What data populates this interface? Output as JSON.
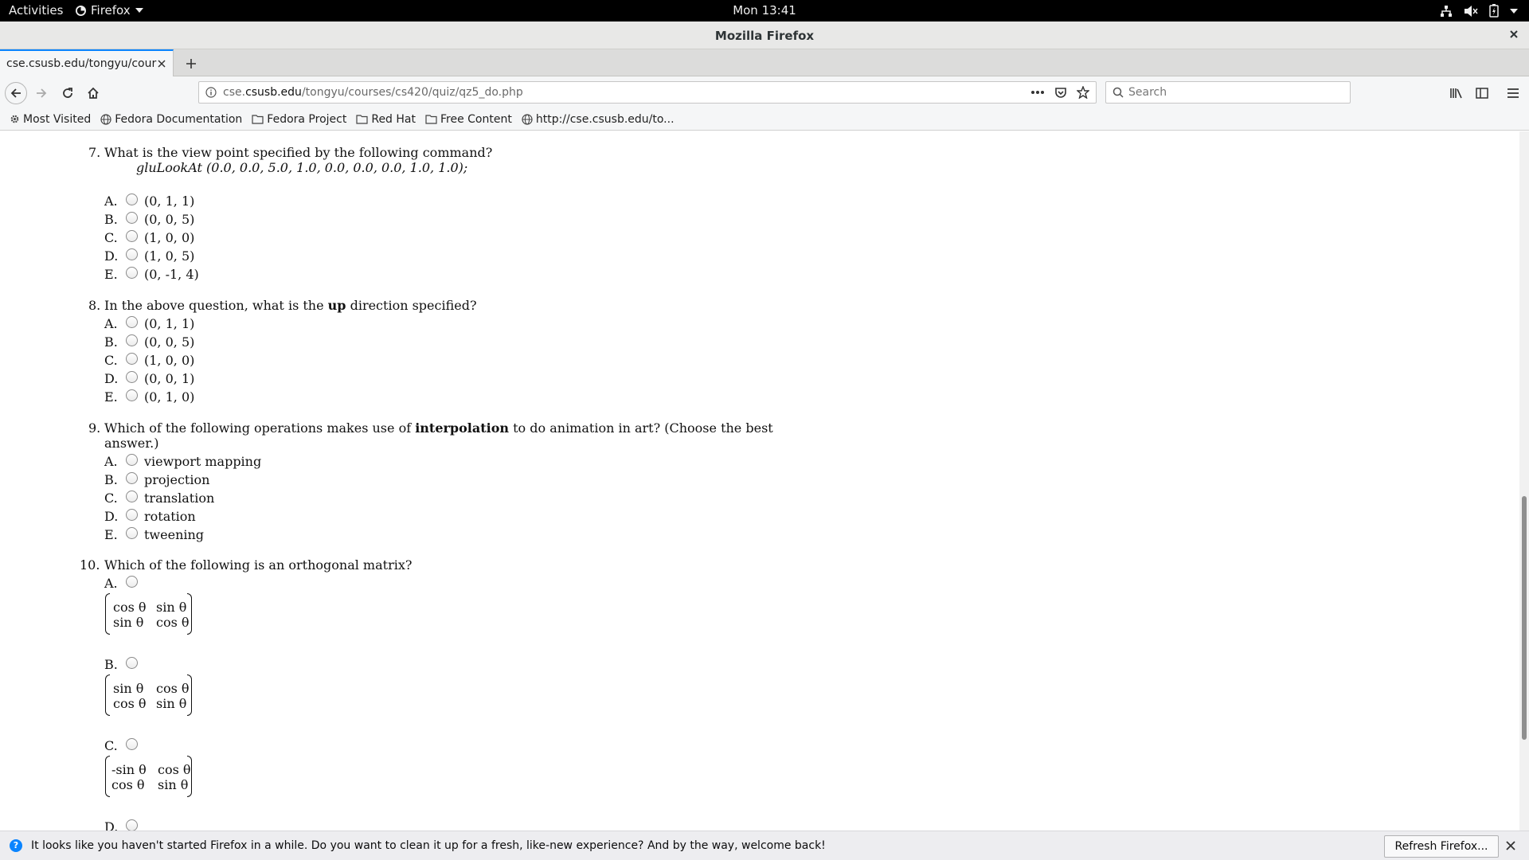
{
  "topbar": {
    "activities": "Activities",
    "app_menu": "Firefox",
    "clock": "Mon 13:41"
  },
  "window": {
    "title": "Mozilla Firefox"
  },
  "tab": {
    "title": "cse.csusb.edu/tongyu/course"
  },
  "urlbar": {
    "url_prefix": "cse.",
    "url_domain": "csusb.edu",
    "url_path": "/tongyu/courses/cs420/quiz/qz5_do.php"
  },
  "searchbar": {
    "placeholder": "Search"
  },
  "bookmarks": [
    {
      "label": "Most Visited",
      "icon": "gear-icon"
    },
    {
      "label": "Fedora Documentation",
      "icon": "globe-icon"
    },
    {
      "label": "Fedora Project",
      "icon": "folder-icon"
    },
    {
      "label": "Red Hat",
      "icon": "folder-icon"
    },
    {
      "label": "Free Content",
      "icon": "folder-icon"
    },
    {
      "label": "http://cse.csusb.edu/to...",
      "icon": "globe-icon"
    }
  ],
  "quiz": {
    "q7": {
      "num": "7.",
      "text": "What is the view point specified by the following command?",
      "code": "gluLookAt (0.0, 0.0, 5.0, 1.0, 0.0, 0.0, 0.0, 1.0, 1.0);",
      "options": [
        {
          "letter": "A.",
          "text": "(0, 1, 1)"
        },
        {
          "letter": "B.",
          "text": "(0, 0, 5)"
        },
        {
          "letter": "C.",
          "text": "(1, 0, 0)"
        },
        {
          "letter": "D.",
          "text": "(1, 0, 5)"
        },
        {
          "letter": "E.",
          "text": "(0, -1, 4)"
        }
      ]
    },
    "q8": {
      "num": "8.",
      "text_before": "In the above question, what is the",
      "text_bold": "up",
      "text_after": "direction specified?",
      "options": [
        {
          "letter": "A.",
          "text": "(0, 1, 1)"
        },
        {
          "letter": "B.",
          "text": "(0, 0, 5)"
        },
        {
          "letter": "C.",
          "text": "(1, 0, 0)"
        },
        {
          "letter": "D.",
          "text": "(0, 0, 1)"
        },
        {
          "letter": "E.",
          "text": "(0, 1, 0)"
        }
      ]
    },
    "q9": {
      "num": "9.",
      "text_before": "Which of the following operations makes use of",
      "text_bold": "interpolation",
      "text_after": "to do animation in art? (Choose the best",
      "text_line2": "answer.)",
      "options": [
        {
          "letter": "A.",
          "text": "viewport mapping"
        },
        {
          "letter": "B.",
          "text": "projection"
        },
        {
          "letter": "C.",
          "text": "translation"
        },
        {
          "letter": "D.",
          "text": "rotation"
        },
        {
          "letter": "E.",
          "text": "tweening"
        }
      ]
    },
    "q10": {
      "num": "10.",
      "text": "Which of the following is an orthogonal matrix?",
      "options": [
        {
          "letter": "A.",
          "matrix": [
            [
              "cos θ",
              "sin θ"
            ],
            [
              "sin θ",
              "cos θ"
            ]
          ]
        },
        {
          "letter": "B.",
          "matrix": [
            [
              "sin θ",
              "cos θ"
            ],
            [
              "cos θ",
              "sin θ"
            ]
          ]
        },
        {
          "letter": "C.",
          "matrix": [
            [
              "-sin θ",
              "cos θ"
            ],
            [
              "cos θ",
              "sin θ"
            ]
          ]
        },
        {
          "letter": "D."
        }
      ]
    }
  },
  "notification": {
    "message": "It looks like you haven't started Firefox in a while. Do you want to clean it up for a fresh, like-new experience? And by the way, welcome back!",
    "button": "Refresh Firefox..."
  }
}
